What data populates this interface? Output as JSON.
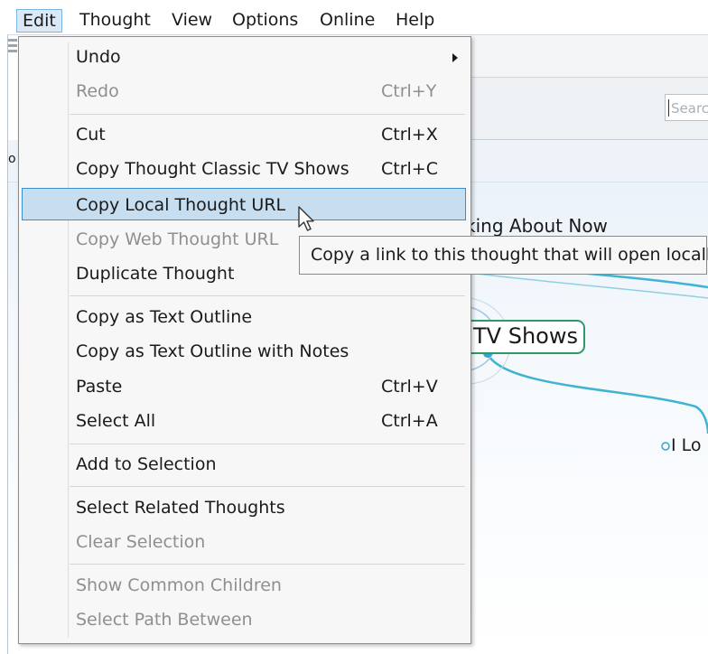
{
  "menubar": {
    "items": [
      "Edit",
      "Thought",
      "View",
      "Options",
      "Online",
      "Help"
    ],
    "active": "Edit"
  },
  "search": {
    "placeholder": "Search"
  },
  "canvas": {
    "partial_label_left": "o",
    "talking_text": "king About Now",
    "main_node_text": "TV Shows",
    "child_text": "I Lo",
    "link_color": "#3fb3cf",
    "node_border_color": "#2e9a6a"
  },
  "edit_menu": {
    "undo": {
      "label": "Undo",
      "submenu_icon": "chevron-right-icon"
    },
    "redo": {
      "label": "Redo",
      "shortcut": "Ctrl+Y"
    },
    "cut": {
      "label": "Cut",
      "shortcut": "Ctrl+X"
    },
    "copy_thought": {
      "label": "Copy Thought Classic TV Shows",
      "shortcut": "Ctrl+C"
    },
    "copy_local_url": {
      "label": "Copy Local Thought URL"
    },
    "copy_web_url": {
      "label": "Copy Web Thought URL"
    },
    "duplicate": {
      "label": "Duplicate Thought"
    },
    "copy_outline": {
      "label": "Copy as Text Outline"
    },
    "copy_outline_notes": {
      "label": "Copy as Text Outline with Notes"
    },
    "paste": {
      "label": "Paste",
      "shortcut": "Ctrl+V"
    },
    "select_all": {
      "label": "Select All",
      "shortcut": "Ctrl+A"
    },
    "add_selection": {
      "label": "Add to Selection"
    },
    "select_related": {
      "label": "Select Related Thoughts"
    },
    "clear_selection": {
      "label": "Clear Selection"
    },
    "show_common": {
      "label": "Show Common Children"
    },
    "select_path": {
      "label": "Select Path Between"
    }
  },
  "tooltip": {
    "text": "Copy a link to this thought that will open locally"
  },
  "colors": {
    "highlight_bg": "#c6def0",
    "highlight_border": "#3b8fd0",
    "disabled_text": "#8f8f8f"
  }
}
